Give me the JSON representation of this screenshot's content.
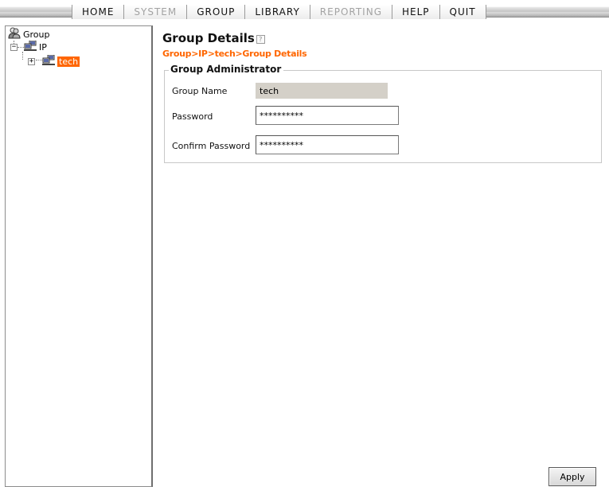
{
  "menu": {
    "items": [
      {
        "label": "HOME",
        "enabled": true
      },
      {
        "label": "SYSTEM",
        "enabled": false
      },
      {
        "label": "GROUP",
        "enabled": true
      },
      {
        "label": "LIBRARY",
        "enabled": true
      },
      {
        "label": "REPORTING",
        "enabled": false
      },
      {
        "label": "HELP",
        "enabled": true
      },
      {
        "label": "QUIT",
        "enabled": true
      }
    ]
  },
  "tree": {
    "root": {
      "label": "Group",
      "icon": "users-group-icon"
    },
    "ip": {
      "label": "IP",
      "icon": "network-computer-icon",
      "expander": "−"
    },
    "tech": {
      "label": "tech",
      "icon": "network-computer-icon",
      "expander": "+",
      "selected": true
    }
  },
  "page": {
    "title": "Group Details",
    "help_icon": "?",
    "breadcrumb": "Group>IP>tech>Group Details"
  },
  "form": {
    "legend": "Group Administrator",
    "group_name_label": "Group Name",
    "group_name_value": "tech",
    "password_label": "Password",
    "password_value": "**********",
    "confirm_label": "Confirm Password",
    "confirm_value": "**********"
  },
  "actions": {
    "apply_label": "Apply"
  },
  "colors": {
    "accent": "#ff6600",
    "disabled_menu": "#a3a3a3",
    "readonly_field": "#d4d0c8"
  }
}
